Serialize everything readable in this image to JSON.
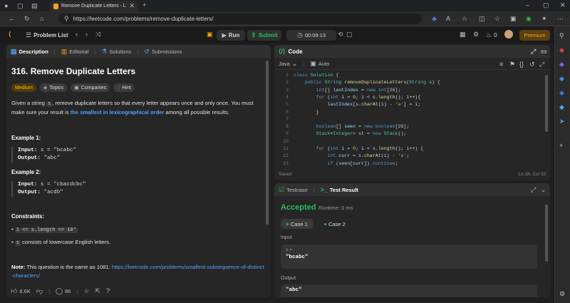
{
  "browser": {
    "tab_title": "Remove Duplicate Letters - Leetc",
    "new_tab": "+",
    "url": "https://leetcode.com/problems/remove-duplicate-letters/"
  },
  "nav": {
    "problem_list": "Problem List",
    "run": "Run",
    "submit": "Submit",
    "timer": "00:09:13",
    "streak": "0",
    "premium": "Premium"
  },
  "left": {
    "tabs": [
      "Description",
      "Editorial",
      "Solutions",
      "Submissions"
    ],
    "title": "316. Remove Duplicate Letters",
    "chips": [
      "Medium",
      "Topics",
      "Companies",
      "Hint"
    ],
    "desc_1": "Given a string ",
    "desc_code": "s",
    "desc_2": ", remove duplicate letters so that every letter appears once and only once. You must make sure your result is ",
    "desc_hl": "the smallest in lexicographical order",
    "desc_3": " among all possible results.",
    "ex1_title": "Example 1:",
    "ex1_input_label": "Input:",
    "ex1_input": "s = \"bcabc\"",
    "ex1_output_label": "Output:",
    "ex1_output": "\"abc\"",
    "ex2_title": "Example 2:",
    "ex2_input_label": "Input:",
    "ex2_input": "s = \"cbacdcbc\"",
    "ex2_output_label": "Output:",
    "ex2_output": "\"acdb\"",
    "constraints_title": "Constraints:",
    "c1_code": "1 <= s.length <= 10⁴",
    "c2_code": "s",
    "c2_text": " consists of lowercase English letters.",
    "note_label": "Note:",
    "note_text": " This question is the same as 1081: ",
    "note_link": "https://leetcode.com/problems/smallest-subsequence-of-distinct-characters/",
    "likes": "8.6K",
    "comments": "86"
  },
  "code": {
    "title": "Code",
    "language": "Java",
    "mode": "Auto",
    "saved": "Saved",
    "cursor": "Ln 18, Col 32",
    "line_numbers": [
      "1",
      "2",
      "3",
      "4",
      "5",
      "6",
      "7",
      "8",
      "9",
      "10",
      "11",
      "12",
      "13"
    ]
  },
  "test": {
    "tab_testcase": "Testcase",
    "tab_result": "Test Result",
    "status": "Accepted",
    "runtime": "Runtime: 0 ms",
    "case1": "Case 1",
    "case2": "Case 2",
    "input_label": "Input",
    "input_var": "s =",
    "input_val": "\"bcabc\"",
    "output_label": "Output",
    "output_val": "\"abc\""
  },
  "colors": {
    "accent_green": "#2cbb5d",
    "accent_orange": "#ffa116",
    "link_blue": "#4ea3ff"
  }
}
